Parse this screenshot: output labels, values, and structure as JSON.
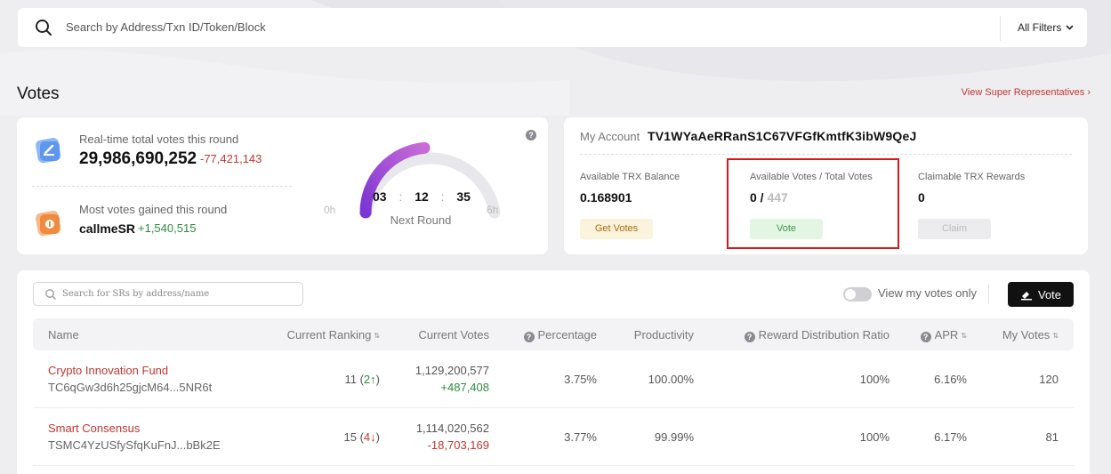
{
  "search": {
    "placeholder": "Search by Address/Txn ID/Token/Block",
    "filter_label": "All Filters"
  },
  "page": {
    "title": "Votes",
    "view_sr_link": "View Super Representatives ›"
  },
  "overview": {
    "total_votes_label": "Real-time total votes this round",
    "total_votes_value": "29,986,690,252",
    "total_votes_change": "-77,421,143",
    "most_gained_label": "Most votes gained this round",
    "most_gained_name": "callmeSR",
    "most_gained_change": "+1,540,515",
    "timer": {
      "hours": "03",
      "minutes": "12",
      "seconds": "35",
      "label": "Next Round",
      "min_label": "0h",
      "max_label": "6h",
      "progress": 0.47
    },
    "help_mark": "?"
  },
  "account": {
    "label": "My Account",
    "address": "TV1WYaAeRRanS1C67VFGfKmtfK3ibW9QeJ",
    "trx_balance_label": "Available TRX Balance",
    "trx_balance_value": "0.168901",
    "votes_label": "Available Votes / Total Votes",
    "votes_available": "0 /",
    "votes_total": "447",
    "rewards_label": "Claimable TRX Rewards",
    "rewards_value": "0",
    "get_votes_button": "Get Votes",
    "vote_button": "Vote",
    "claim_button": "Claim"
  },
  "table": {
    "search_placeholder": "Search for SRs by address/name",
    "toggle_label": "View my votes only",
    "vote_button": "Vote",
    "columns": [
      "Name",
      "Current Ranking",
      "Current Votes",
      "Percentage",
      "Productivity",
      "Reward Distribution Ratio",
      "APR",
      "My Votes"
    ],
    "rows": [
      {
        "name": "Crypto Innovation Fund",
        "address": "TC6qGw3d6h25gjcM64...5NR6t",
        "ranking": "11",
        "ranking_change": "2↑",
        "votes": "1,129,200,577",
        "votes_change": "+487,408",
        "percentage": "3.75%",
        "productivity": "100.00%",
        "reward_ratio": "100%",
        "apr": "6.16%",
        "my_votes": "120"
      },
      {
        "name": "Smart Consensus",
        "address": "TSMC4YzUSfySfqKuFnJ...bBk2E",
        "ranking": "15",
        "ranking_change": "4↓",
        "votes": "1,114,020,562",
        "votes_change": "-18,703,169",
        "percentage": "3.77%",
        "productivity": "99.99%",
        "reward_ratio": "100%",
        "apr": "6.17%",
        "my_votes": "81"
      }
    ]
  },
  "colors": {
    "accent_red": "#c23631",
    "positive_green": "#2e8b3e",
    "gauge_purple": "#8e3fd6",
    "highlight_red": "#d7191c"
  }
}
